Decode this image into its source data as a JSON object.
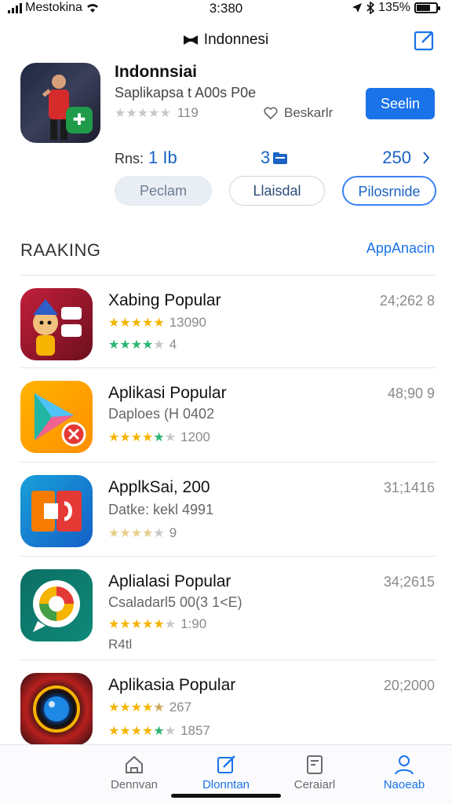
{
  "status_bar": {
    "carrier": "Mestokina",
    "time": "3:380",
    "battery_pct": "135%"
  },
  "nav": {
    "title": "Indonnesi"
  },
  "hero": {
    "name": "Indonnsiai",
    "subtitle": "Saplikapsa t A00s P0e",
    "rating_count": "119",
    "bookmark_label": "Beskarlr",
    "get_label": "Seelin",
    "stars": {
      "gold": 0,
      "grey": 5
    }
  },
  "stats": {
    "label": "Rns:",
    "value1": "1 Ib",
    "value2": "3",
    "value3": "250"
  },
  "pills": [
    "Peclam",
    "Llaisdal",
    "Pilosrnide"
  ],
  "section": {
    "title": "RAAKING",
    "link": "AppAnacin"
  },
  "apps": [
    {
      "title": "Xabing Popular",
      "count": "24;262 8",
      "sub": "",
      "rating1": "13090",
      "rating2": "4",
      "colors": [
        "#c21f3a",
        "#6d0f1e"
      ]
    },
    {
      "title": "Aplikasi Popular",
      "count": "48;90 9",
      "sub": "Daploes (H 0402",
      "rating1": "1200",
      "rating2": "",
      "colors": [
        "#ffb300",
        "#ff8f00"
      ]
    },
    {
      "title": "ApplkSai, 200",
      "count": "31;1416",
      "sub": "Datke: kekl 4991",
      "rating1": "9",
      "rating2": "",
      "colors": [
        "#18a0d8",
        "#1560c8"
      ]
    },
    {
      "title": "Aplialasi Popular",
      "count": "34;2615",
      "sub": "Csaladarl5 00(3 1<E)",
      "rating1": "1:90",
      "rating2": "R4tl",
      "colors": [
        "#0b6e63",
        "#0f8a7a"
      ]
    },
    {
      "title": "Aplikasia Popular",
      "count": "20;2000",
      "sub": "",
      "rating1": "267",
      "rating2": "1857",
      "colors": [
        "#2a0e14",
        "#b8201e"
      ]
    }
  ],
  "tabs": [
    {
      "label": "Dennvan",
      "icon": "home-icon",
      "active": false
    },
    {
      "label": "Dlonntan",
      "icon": "compose-icon",
      "active": true
    },
    {
      "label": "Ceraiarl",
      "icon": "document-icon",
      "active": false
    },
    {
      "label": "Naoeab",
      "icon": "person-icon",
      "active": false
    }
  ],
  "colors": {
    "accent": "#1a73e8",
    "star_gold": "#f5b400",
    "star_teal": "#2bb673"
  }
}
